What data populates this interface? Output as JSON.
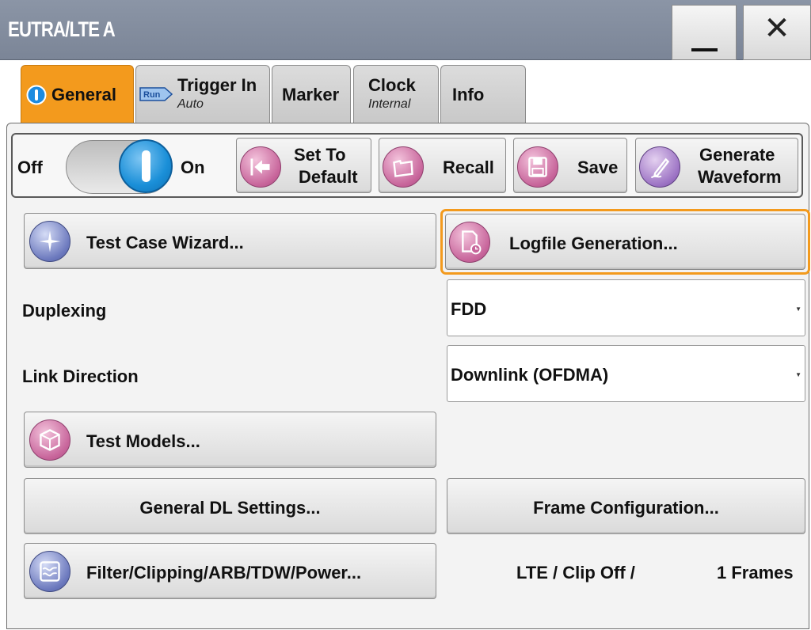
{
  "window": {
    "title": "EUTRA/LTE A",
    "minimize_icon": "minimize-icon",
    "close_label": "✕"
  },
  "tabs": [
    {
      "label": "General",
      "sub": "",
      "icon": "info-icon",
      "active": true
    },
    {
      "label": "Trigger In",
      "sub": "Auto",
      "icon": "run-icon",
      "icon_text": "Run",
      "active": false
    },
    {
      "label": "Marker",
      "sub": "",
      "active": false
    },
    {
      "label": "Clock",
      "sub": "Internal",
      "active": false
    },
    {
      "label": "Info",
      "sub": "",
      "active": false
    }
  ],
  "toolbar": {
    "off_label": "Off",
    "on_label": "On",
    "state": "On",
    "set_default_label_1": "Set To",
    "set_default_label_2": "Default",
    "recall_label": "Recall",
    "save_label": "Save",
    "generate_label_1": "Generate",
    "generate_label_2": "Waveform"
  },
  "main": {
    "test_case_wizard": "Test Case Wizard...",
    "logfile_generation": "Logfile Generation...",
    "duplexing_label": "Duplexing",
    "duplexing_value": "FDD",
    "link_direction_label": "Link Direction",
    "link_direction_value": "Downlink (OFDMA)",
    "test_models": "Test Models...",
    "general_dl_settings": "General DL Settings...",
    "frame_configuration": "Frame Configuration...",
    "filter_label": "Filter/Clipping/ARB/TDW/Power...",
    "filter_status": "LTE / Clip Off /",
    "frames_status": "1 Frames"
  },
  "colors": {
    "active_tab": "#f39a1d",
    "focus_outline": "#f39a1d",
    "toggle_on": "#1a8fd8",
    "titlebar": "#8390a3"
  }
}
